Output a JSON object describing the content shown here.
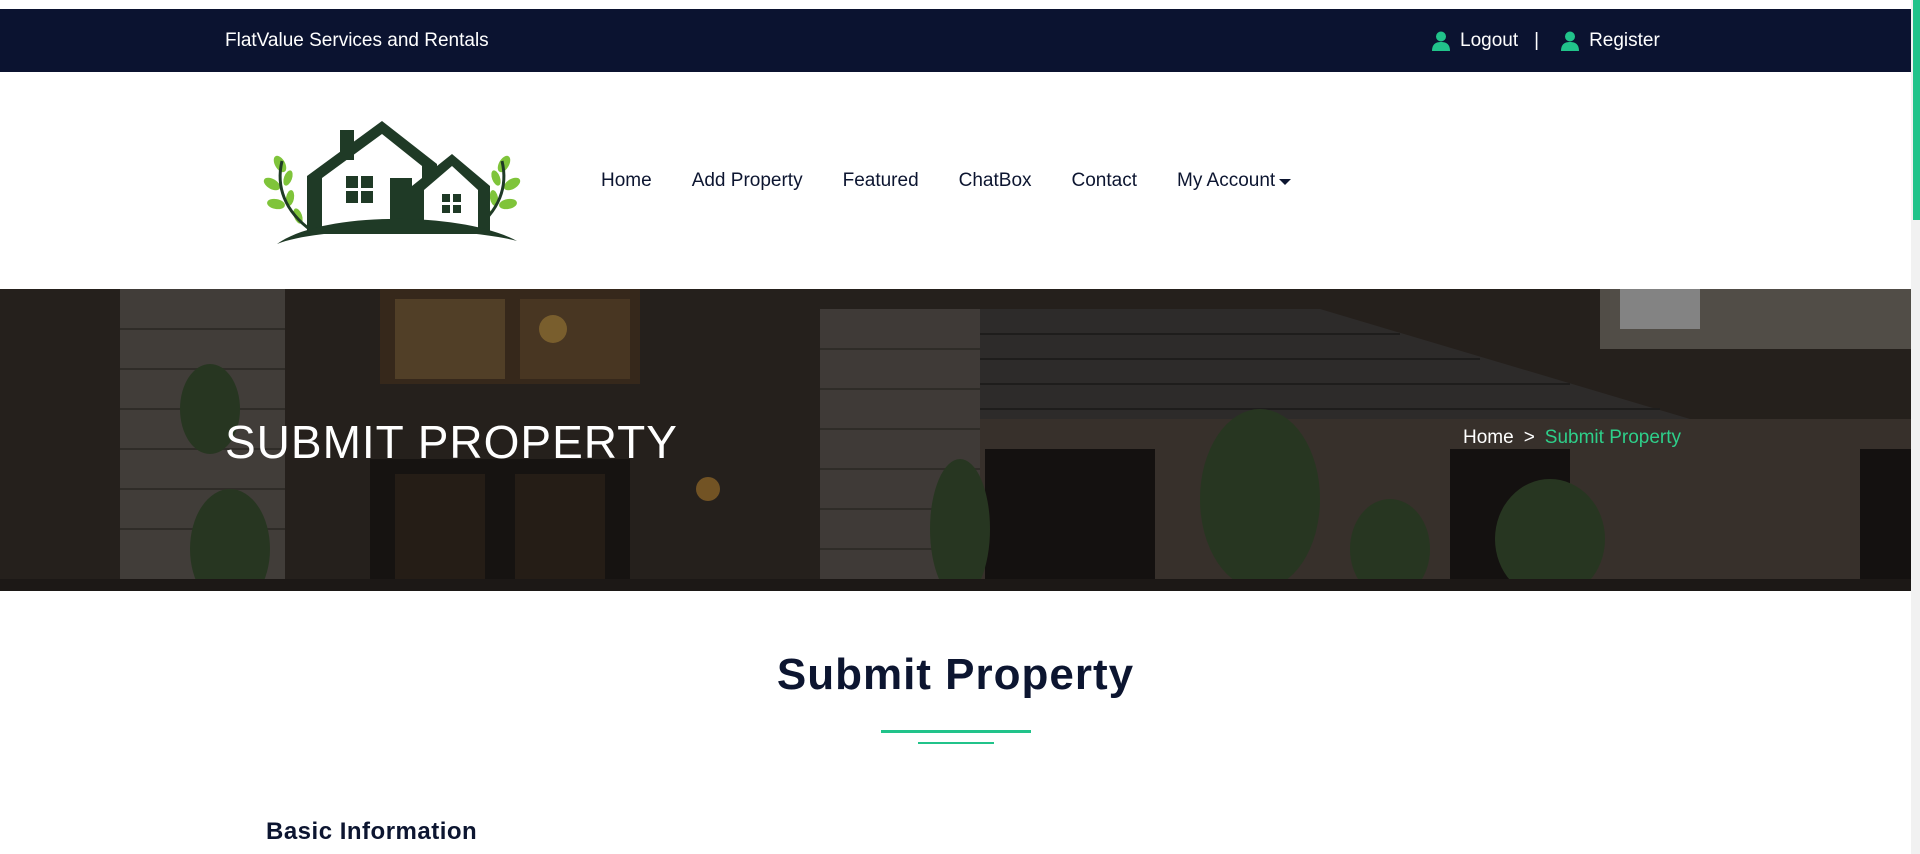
{
  "topbar": {
    "company_name": "FlatValue Services and Rentals",
    "logout_label": "Logout",
    "separator": "|",
    "register_label": "Register"
  },
  "nav": {
    "items": [
      {
        "label": "Home"
      },
      {
        "label": "Add Property"
      },
      {
        "label": "Featured"
      },
      {
        "label": "ChatBox"
      },
      {
        "label": "Contact"
      },
      {
        "label": "My Account"
      }
    ]
  },
  "hero": {
    "title": "SUBMIT PROPERTY",
    "breadcrumb": {
      "home": "Home",
      "separator": ">",
      "current": "Submit Property"
    }
  },
  "main": {
    "section_title": "Submit Property",
    "subheading": "Basic Information"
  },
  "colors": {
    "topbar_bg": "#0b1330",
    "accent": "#21c38a",
    "text_dark": "#0c1530",
    "logo_green": "#1f3a26"
  },
  "icons": {
    "logout": "user-icon",
    "register": "user-icon",
    "dropdown": "caret-down-icon"
  }
}
